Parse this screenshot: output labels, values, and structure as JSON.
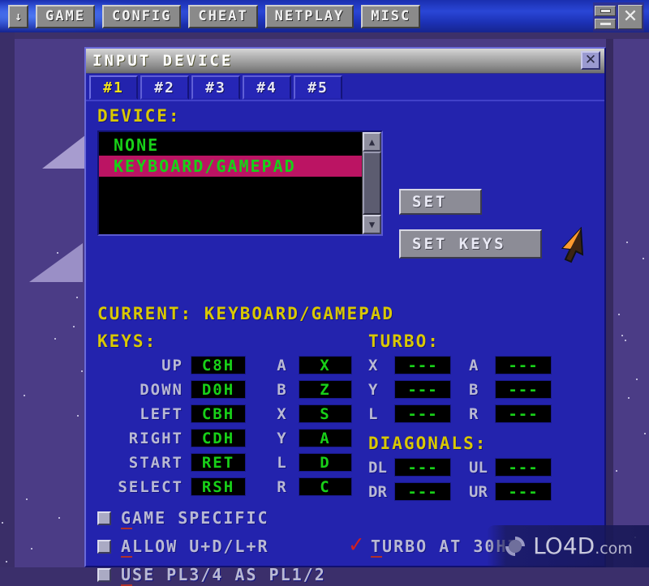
{
  "menubar": {
    "arrow_label": "↓",
    "items": [
      {
        "label": "GAME"
      },
      {
        "label": "CONFIG"
      },
      {
        "label": "CHEAT"
      },
      {
        "label": "NETPLAY"
      },
      {
        "label": "MISC"
      }
    ],
    "window_controls": {
      "restore_icon": "restore-icon",
      "minimize_icon": "minimize-icon",
      "close_label": "✕"
    }
  },
  "dialog": {
    "title": "INPUT DEVICE",
    "close_label": "✕",
    "tabs": [
      {
        "label": "#1",
        "active": true
      },
      {
        "label": "#2",
        "active": false
      },
      {
        "label": "#3",
        "active": false
      },
      {
        "label": "#4",
        "active": false
      },
      {
        "label": "#5",
        "active": false
      }
    ],
    "device_label": "DEVICE:",
    "device_list": [
      {
        "label": "NONE",
        "selected": false
      },
      {
        "label": "KEYBOARD/GAMEPAD",
        "selected": true
      }
    ],
    "scroll": {
      "up_arrow": "▲",
      "down_arrow": "▼"
    },
    "buttons": {
      "set": "SET",
      "set_keys": "SET KEYS"
    },
    "current_line": "CURRENT: KEYBOARD/GAMEPAD",
    "keys_label": "KEYS:",
    "turbo_label": "TURBO:",
    "diagonals_label": "DIAGONALS:",
    "keys": [
      {
        "name": "UP",
        "value": "C8H"
      },
      {
        "name": "DOWN",
        "value": "D0H"
      },
      {
        "name": "LEFT",
        "value": "CBH"
      },
      {
        "name": "RIGHT",
        "value": "CDH"
      },
      {
        "name": "START",
        "value": "RET"
      },
      {
        "name": "SELECT",
        "value": "RSH"
      }
    ],
    "buttons_map": [
      {
        "name": "A",
        "value": "X"
      },
      {
        "name": "B",
        "value": "Z"
      },
      {
        "name": "X",
        "value": "S"
      },
      {
        "name": "Y",
        "value": "A"
      },
      {
        "name": "L",
        "value": "D"
      },
      {
        "name": "R",
        "value": "C"
      }
    ],
    "turbo": [
      {
        "name": "X",
        "value": "---"
      },
      {
        "name": "A",
        "value": "---"
      },
      {
        "name": "Y",
        "value": "---"
      },
      {
        "name": "B",
        "value": "---"
      },
      {
        "name": "L",
        "value": "---"
      },
      {
        "name": "R",
        "value": "---"
      }
    ],
    "diagonals": [
      {
        "name": "DL",
        "value": "---"
      },
      {
        "name": "UL",
        "value": "---"
      },
      {
        "name": "DR",
        "value": "---"
      },
      {
        "name": "UR",
        "value": "---"
      }
    ],
    "checkboxes": [
      {
        "label": "GAME SPECIFIC",
        "accel": "G",
        "checked": false
      },
      {
        "label": "ALLOW U+D/L+R",
        "accel": "A",
        "checked": false
      },
      {
        "label": "TURBO AT 30HZ",
        "accel": "T",
        "checked": true
      },
      {
        "label": "USE PL3/4 AS PL1/2",
        "accel": "U",
        "checked": false
      }
    ]
  },
  "watermark": {
    "text": "LO4D",
    "suffix": ".com"
  },
  "colors": {
    "dialog_bg": "#2323ad",
    "label_yellow": "#d9c800",
    "value_green": "#18d018",
    "selection_magenta": "#bb1463",
    "menubar_blue": "#2a46d6",
    "desktop_purple": "#4b3c86",
    "check_red": "#d02020"
  }
}
